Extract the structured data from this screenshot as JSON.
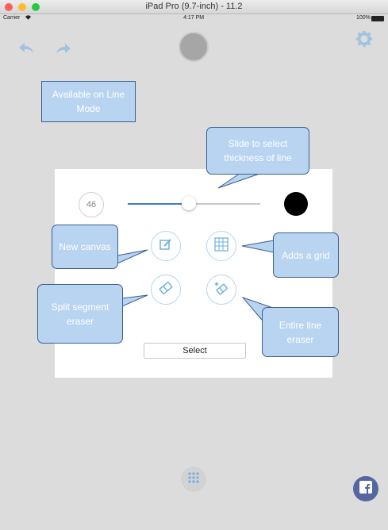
{
  "window": {
    "title": "iPad Pro (9.7-inch) - 11.2"
  },
  "status_bar": {
    "carrier": "Carrier",
    "time": "4:17 PM",
    "battery": "100%"
  },
  "toolbar": {
    "undo_icon": "undo-arrow-icon",
    "redo_icon": "redo-arrow-icon",
    "settings_icon": "gear-icon",
    "current_color": "#a6a6a6"
  },
  "panel": {
    "thickness_value": "46",
    "thickness_level_percent": 47,
    "selected_color": "#000000",
    "tools": [
      "new-canvas",
      "grid",
      "split-segment-eraser",
      "entire-line-eraser"
    ],
    "select_label": "Select"
  },
  "callouts": {
    "line_mode": "Available on Line Mode",
    "slide": "Slide to select thickness of line",
    "new_canvas": "New canvas",
    "adds_grid": "Adds a grid",
    "split_eraser": "Split segment eraser",
    "entire_eraser": "Entire line eraser"
  },
  "bottom": {
    "menu_icon": "dots-grid-icon",
    "share_icon": "facebook-icon"
  },
  "colors": {
    "accent": "#6fb2e2",
    "callout_bg": "#b9d4f1",
    "callout_border": "#3a5f8f",
    "facebook": "#5467a0"
  }
}
